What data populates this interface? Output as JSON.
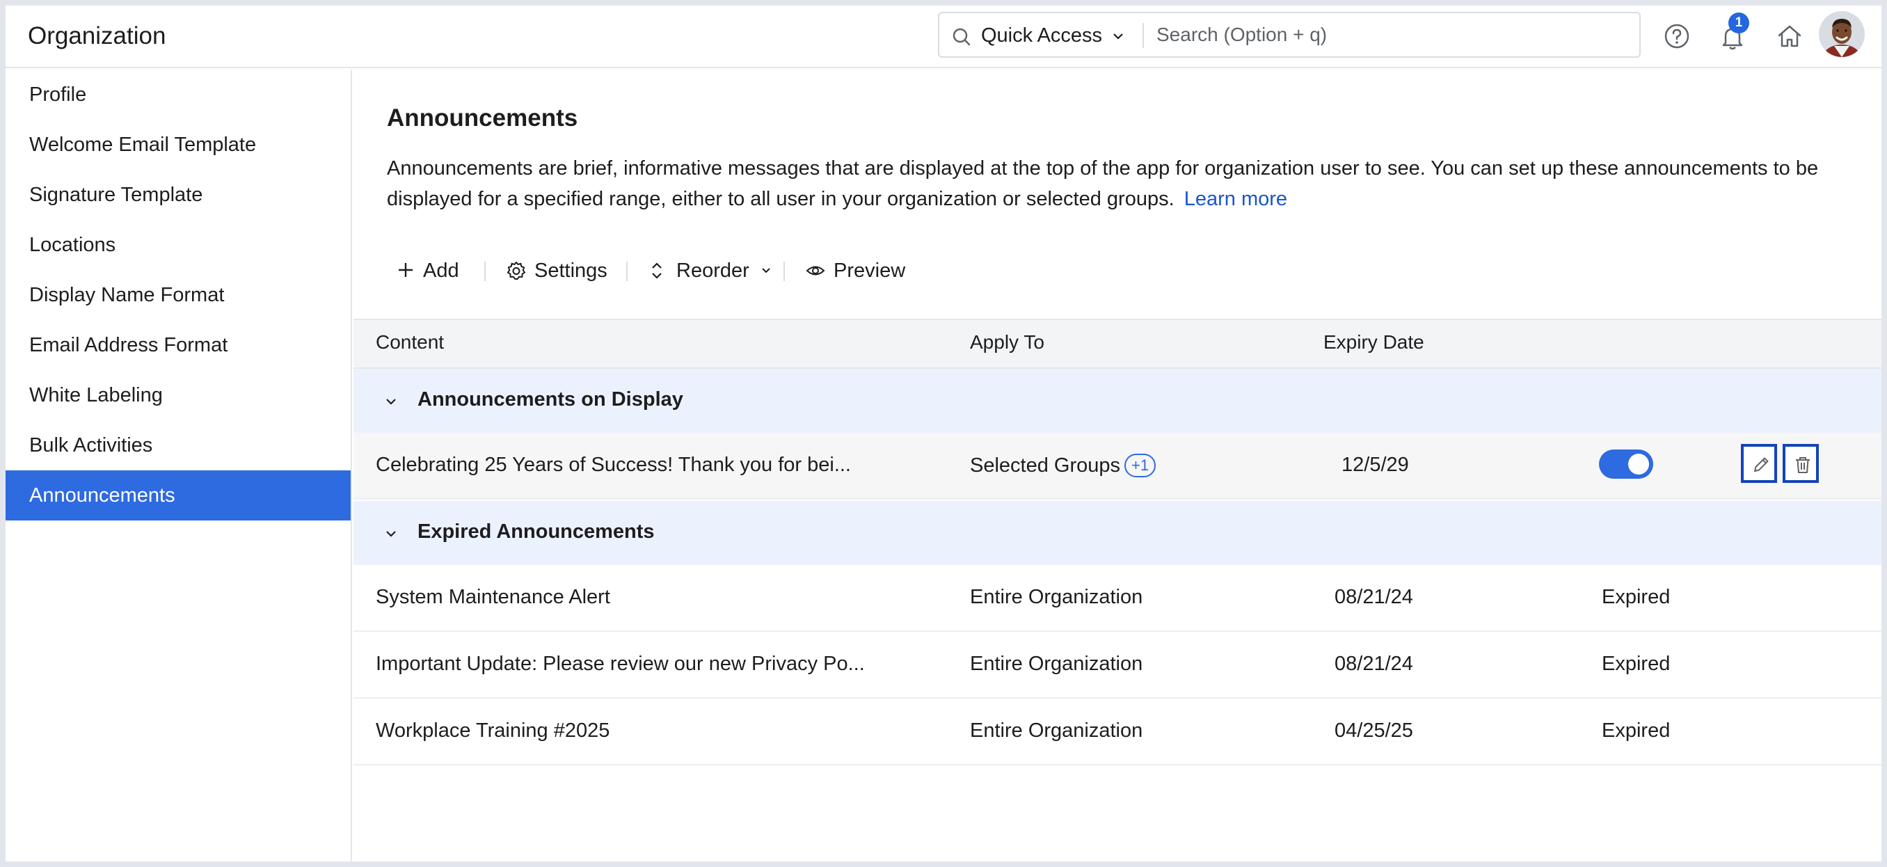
{
  "header": {
    "title": "Organization",
    "quick_access": "Quick Access",
    "search_placeholder": "Search (Option + q)",
    "notification_count": "1"
  },
  "sidebar": {
    "items": [
      {
        "label": "Profile"
      },
      {
        "label": "Welcome Email Template"
      },
      {
        "label": "Signature Template"
      },
      {
        "label": "Locations"
      },
      {
        "label": "Display Name Format"
      },
      {
        "label": "Email Address Format"
      },
      {
        "label": "White Labeling"
      },
      {
        "label": "Bulk Activities"
      },
      {
        "label": "Announcements",
        "active": true
      }
    ]
  },
  "main": {
    "title": "Announcements",
    "description": "Announcements are brief, informative messages that are displayed at the top of the app for organization user to see. You can set up these announcements to be displayed for a specified range, either to all user in your organization or selected groups.",
    "learn_more": "Learn more",
    "toolbar": {
      "add": "Add",
      "settings": "Settings",
      "reorder": "Reorder",
      "preview": "Preview"
    }
  },
  "table": {
    "columns": [
      "Content",
      "Apply To",
      "Expiry Date"
    ],
    "groups": [
      {
        "label": "Announcements on Display",
        "rows": [
          {
            "content": "Celebrating 25 Years of Success! Thank you for bei...",
            "apply_to": "Selected Groups",
            "apply_badge": "+1",
            "expiry": "12/5/29",
            "enabled": true
          }
        ]
      },
      {
        "label": "Expired Announcements",
        "rows": [
          {
            "content": "System Maintenance Alert",
            "apply_to": "Entire Organization",
            "expiry": "08/21/24",
            "status": "Expired"
          },
          {
            "content": "Important Update: Please review our new Privacy Po...",
            "apply_to": "Entire Organization",
            "expiry": "08/21/24",
            "status": "Expired"
          },
          {
            "content": "Workplace Training #2025",
            "apply_to": "Entire Organization",
            "expiry": "04/25/25",
            "status": "Expired"
          }
        ]
      }
    ]
  },
  "colors": {
    "accent": "#2e6ae0",
    "link": "#1a56c8",
    "group_bg": "#ecf2fd",
    "action_border": "#1443b8"
  }
}
